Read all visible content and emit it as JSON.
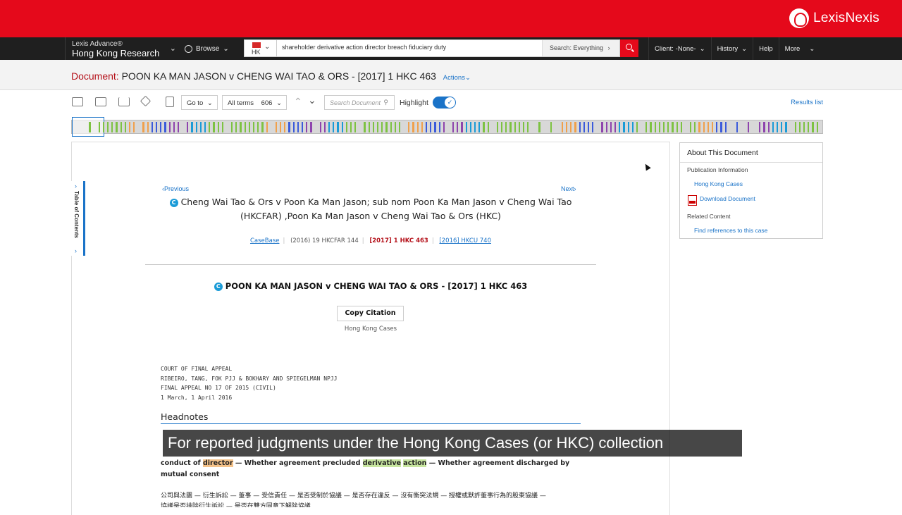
{
  "header": {
    "brand": "LexisNexis"
  },
  "nav": {
    "product_line1": "Lexis Advance®",
    "product_line2": "Hong Kong Research",
    "browse": "Browse",
    "country_code": "HK",
    "search_query": "shareholder derivative action director breach fiduciary duty",
    "search_scope": "Search: Everything",
    "client": "Client: -None-",
    "history": "History",
    "help": "Help",
    "more": "More"
  },
  "document": {
    "label": "Document:",
    "title": "POON KA MAN JASON v CHENG WAI TAO & ORS - [2017] 1 HKC 463",
    "actions": "Actions"
  },
  "toolbar": {
    "goto": "Go to",
    "terms": "All terms",
    "terms_count": "606",
    "search_placeholder": "Search Document",
    "highlight": "Highlight",
    "highlight_on": true,
    "results_list": "Results list"
  },
  "content": {
    "toc": "Table of Contents",
    "prev": "Previous",
    "next": "Next",
    "related_case": "Cheng Wai Tao & Ors v Poon Ka Man Jason; sub nom Poon Ka Man Jason v Cheng Wai Tao (HKCFAR) ,Poon Ka Man Jason v Cheng Wai Tao & Ors (HKC)",
    "cite_casebase": "CaseBase",
    "cite_1": "(2016) 19 HKCFAR 144",
    "cite_2": "[2017] 1 HKC 463",
    "cite_3": "[2016] HKCU 740",
    "main_title": "POON KA MAN JASON v CHENG WAI TAO & ORS - [2017] 1 HKC 463",
    "copy_citation": "Copy Citation",
    "collection": "Hong Kong Cases",
    "court": "COURT OF FINAL APPEAL",
    "judges": "RIBEIRO, TANG, FOK PJJ & BOKHARY AND SPIEGELMAN NPJJ",
    "appeal_no": "FINAL APPEAL NO 17 OF 2015 (CIVIL)",
    "dates": "1 March, 1 April 2016",
    "headnotes": "Headnotes",
    "catch_1": "conduct of ",
    "catch_director": "director",
    "catch_2": " — Whether agreement precluded ",
    "catch_derivative": "derivative",
    "catch_3": " ",
    "catch_action": "action",
    "catch_4": " — Whether agreement discharged by mutual consent",
    "chinese_1": "公司與法團 — 衍生訴訟 — 董事 — 受信責任 — 是否受制於協議 — 是否存在違反 — 沒有衝突法規 — 授權或默許董事行為的股東協議 —",
    "chinese_2": "協議是否排除衍生訴訟 — 是否在雙方同意下解除協議"
  },
  "caption": "For reported judgments under the Hong Kong Cases (or HKC) collection",
  "about": {
    "title": "About This Document",
    "pub_info": "Publication Information",
    "hkc": "Hong Kong Cases",
    "download": "Download Document",
    "related": "Related Content",
    "find_refs": "Find references to this case"
  },
  "colors": {
    "brand_red": "#e5091b",
    "link_blue": "#1a73c8",
    "hit_green": "#7dc242",
    "hit_orange": "#f0a04b"
  }
}
